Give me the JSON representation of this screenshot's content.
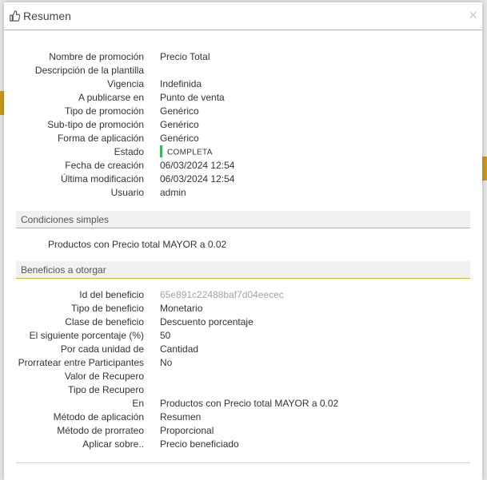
{
  "modal": {
    "title": "Resumen",
    "close_label": "×",
    "icon": "thumbs-up-icon"
  },
  "summary": [
    {
      "label": "Nombre de promoción",
      "value": "Precio Total"
    },
    {
      "label": "Descripción de la plantilla",
      "value": ""
    },
    {
      "label": "Vigencia",
      "value": "Indefinida"
    },
    {
      "label": "A publicarse en",
      "value": "Punto de venta"
    },
    {
      "label": "Tipo de promoción",
      "value": "Genérico"
    },
    {
      "label": "Sub-tipo de promoción",
      "value": "Genérico"
    },
    {
      "label": "Forma de aplicación",
      "value": "Genérico"
    },
    {
      "label": "Estado",
      "value": "COMPLETA"
    },
    {
      "label": "Fecha de creación",
      "value": "06/03/2024 12:54"
    },
    {
      "label": "Última modificación",
      "value": "06/03/2024 12:54"
    },
    {
      "label": "Usuario",
      "value": "admin"
    }
  ],
  "status_color": "#3cb35c",
  "conditions": {
    "title": "Condiciones simples",
    "text": "Productos con Precio total MAYOR a 0.02"
  },
  "benefits": {
    "title": "Beneficios a otorgar",
    "rows": [
      {
        "label": "Id del beneficio",
        "value": "65e891c22488baf7d04eecec"
      },
      {
        "label": "Tipo de beneficio",
        "value": "Monetario"
      },
      {
        "label": "Clase de beneficio",
        "value": "Descuento porcentaje"
      },
      {
        "label": "El siguiente porcentaje (%)",
        "value": "50"
      },
      {
        "label": "Por cada unidad de",
        "value": "Cantidad"
      },
      {
        "label": "Prorratear entre Participantes",
        "value": "No"
      },
      {
        "label": "Valor de Recupero",
        "value": ""
      },
      {
        "label": "Tipo de Recupero",
        "value": ""
      },
      {
        "label": "En",
        "value": "Productos con Precio total MAYOR a 0.02"
      },
      {
        "label": "Método de aplicación",
        "value": "Resumen"
      },
      {
        "label": "Método de prorrateo",
        "value": "Proporcional"
      },
      {
        "label": "Aplicar sobre..",
        "value": "Precio beneficiado"
      }
    ]
  },
  "accent_color": "#e6b22c"
}
